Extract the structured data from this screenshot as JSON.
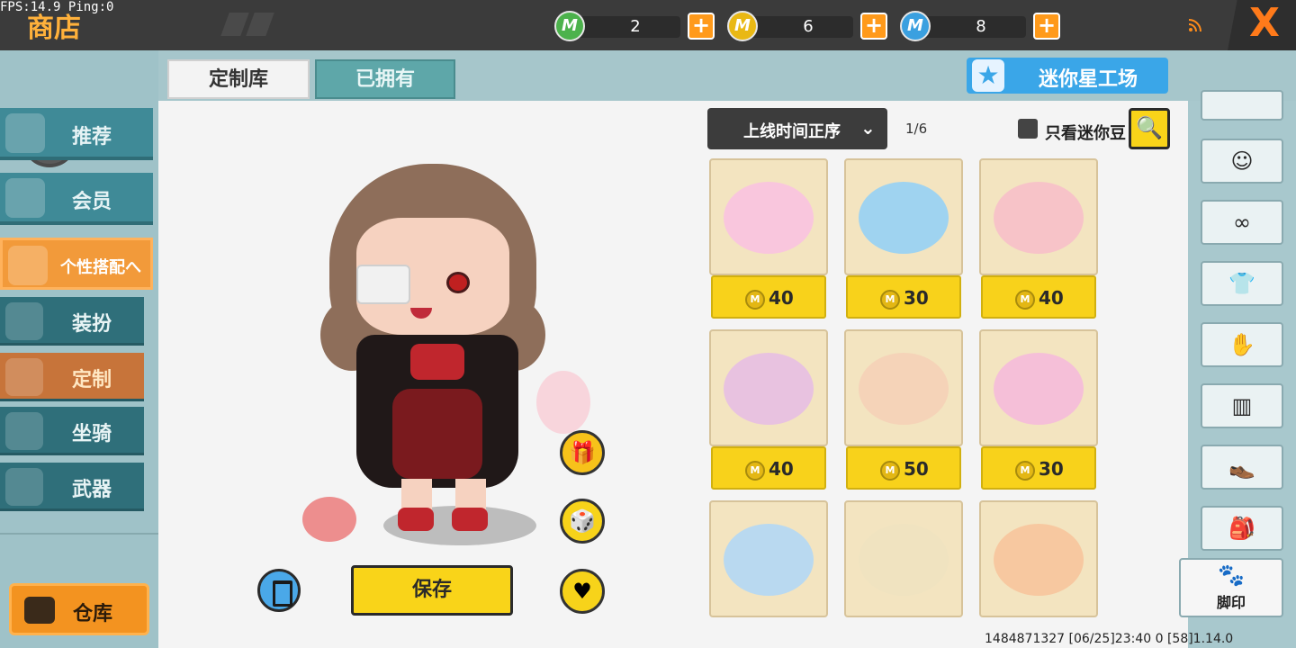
{
  "debug": {
    "fps": "FPS:14.9",
    "ping": "Ping:0"
  },
  "header": {
    "title": "商店",
    "currencies": [
      {
        "icon": "green-m-coin-icon",
        "value": "2",
        "color": "#4cb24c"
      },
      {
        "icon": "gold-m-coin-icon",
        "value": "6",
        "color": "#e9b814"
      },
      {
        "icon": "blue-m-coin-icon",
        "value": "8",
        "color": "#3aa0e0"
      }
    ],
    "plus": "+",
    "close": "X"
  },
  "sidebar": {
    "items": [
      {
        "label": "推荐"
      },
      {
        "label": "会员"
      },
      {
        "label": "个性搭配へ"
      }
    ],
    "sub_items": [
      {
        "label": "装扮"
      },
      {
        "label": "定制"
      },
      {
        "label": "坐骑"
      },
      {
        "label": "武器"
      }
    ],
    "warehouse": "仓库"
  },
  "tabs": {
    "active": "定制库",
    "inactive": "已拥有"
  },
  "workshop": {
    "label": "迷你星工场",
    "star": "★"
  },
  "toolbar": {
    "sort_label": "上线时间正序",
    "page": "1/6",
    "only_beans": "只看迷你豆"
  },
  "items": [
    {
      "price": "40",
      "tint": "#f9c6dd"
    },
    {
      "price": "30",
      "tint": "#9fd3f0"
    },
    {
      "price": "40",
      "tint": "#f7c3c8"
    },
    {
      "price": "40",
      "tint": "#e8c2e0"
    },
    {
      "price": "50",
      "tint": "#f5d3b8"
    },
    {
      "price": "30",
      "tint": "#f5bfd8"
    },
    {
      "price": "",
      "tint": "#b9d9f0"
    },
    {
      "price": "",
      "tint": "#f0e3c0"
    },
    {
      "price": "",
      "tint": "#f7c8a0"
    }
  ],
  "character": {
    "save_label": "保存"
  },
  "footprint": {
    "label": "脚印",
    "icon": "paw-icon"
  },
  "status": "1484871327    [06/25]23:40 0  [58]1.14.0",
  "colors": {
    "accent": "#f9d419",
    "orange": "#f29a3a",
    "teal": "#3f8a97"
  }
}
